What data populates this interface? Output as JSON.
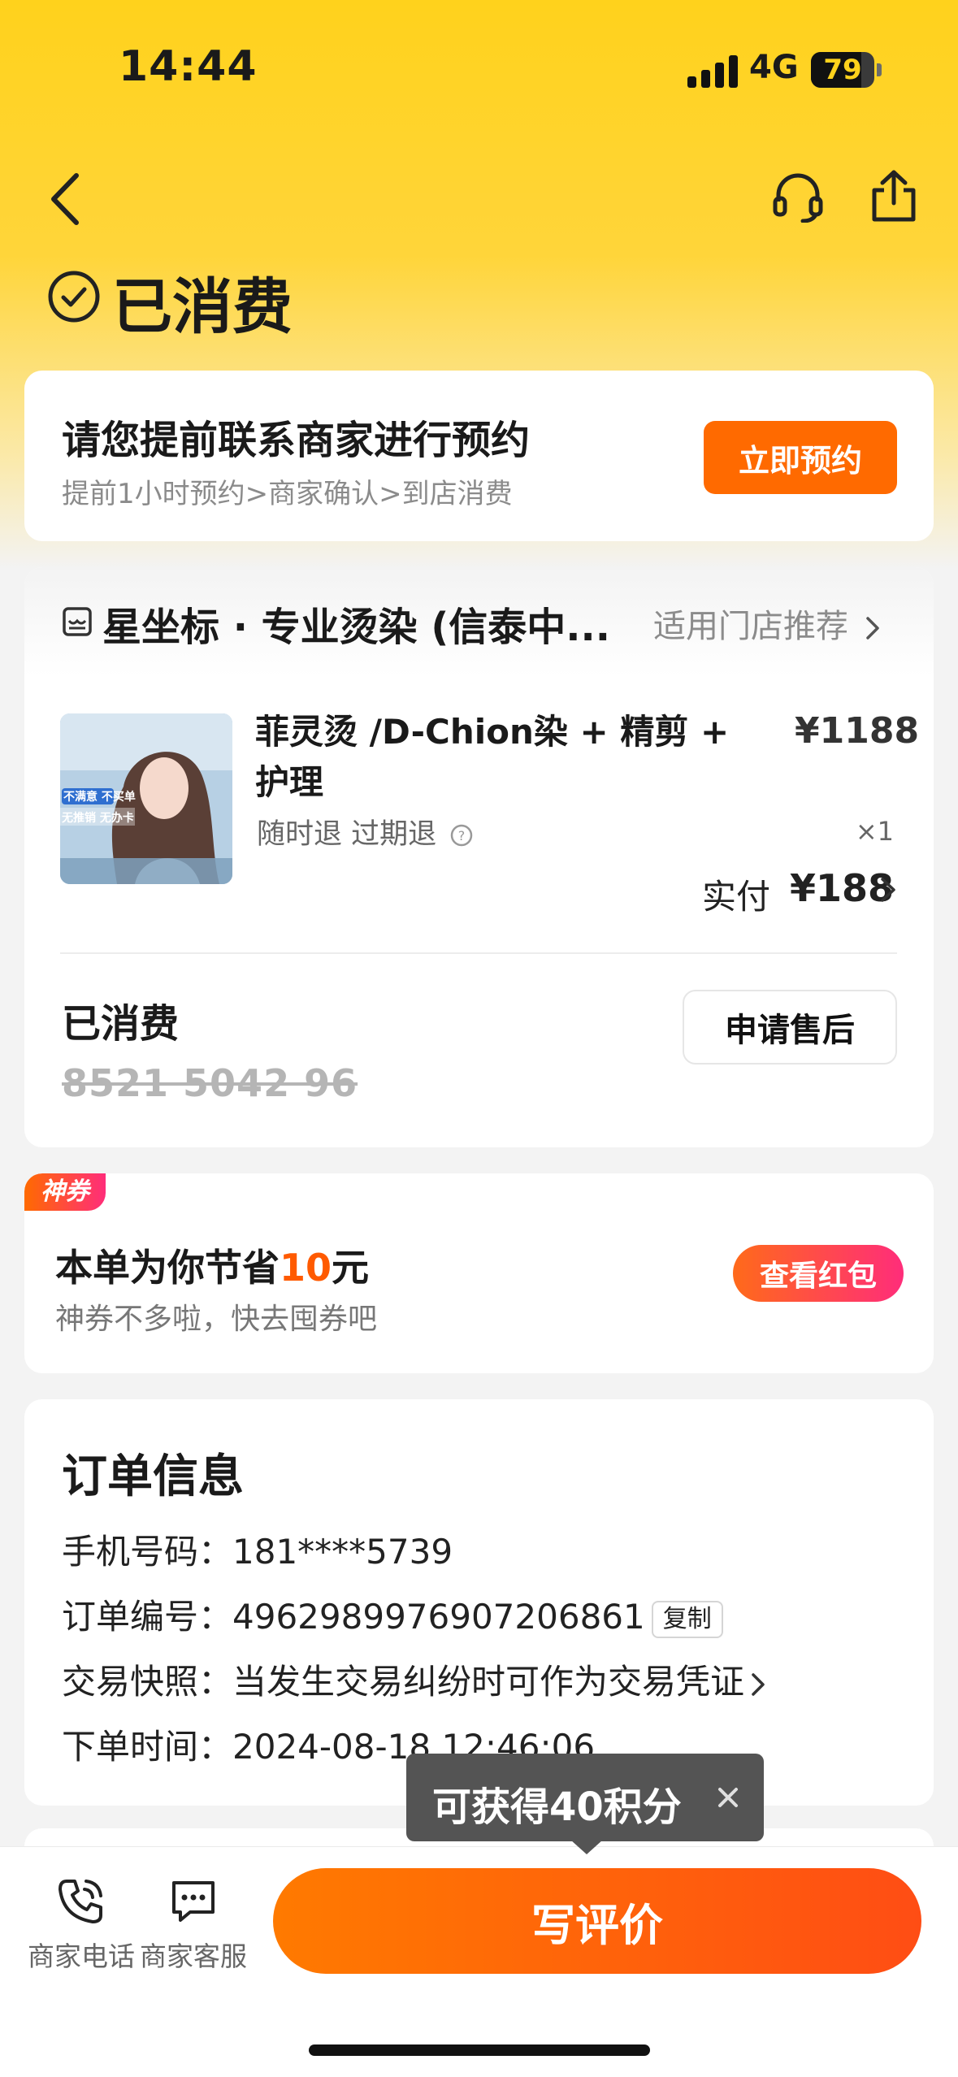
{
  "status_bar": {
    "time": "14:44",
    "network": "4G",
    "battery_level": 79,
    "battery_label": "79"
  },
  "header": {
    "status_title": "已消费",
    "icons": [
      "back-icon",
      "headset-icon",
      "share-icon",
      "check-circle-icon"
    ]
  },
  "reserve": {
    "title": "请您提前联系商家进行预约",
    "subtitle": "提前1小时预约>商家确认>到店消费",
    "button": "立即预约"
  },
  "shop": {
    "name": "星坐标 · 专业烫染 (信泰中...",
    "recommend": "适用门店推荐"
  },
  "product": {
    "image_badge_1": "不满意 不买单",
    "image_badge_2": "无推销 无办卡",
    "title": "菲灵烫 /D-Chion染 + 精剪 + 护理",
    "price": "¥1188",
    "refund_policy": "随时退 过期退",
    "quantity": "×1",
    "paid_label": "实付",
    "paid_value": "¥188"
  },
  "voucher": {
    "status": "已消费",
    "code": "8521 5042 96",
    "aftersale_button": "申请售后"
  },
  "coupon": {
    "badge": "神券",
    "title_prefix": "本单为你节省",
    "saved_amount": "10",
    "title_suffix": "元",
    "subtitle": "神券不多啦，快去囤券吧",
    "button": "查看红包"
  },
  "order_info": {
    "title": "订单信息",
    "phone_label": "手机号码：",
    "phone": "181****5739",
    "order_no_label": "订单编号：",
    "order_no": "4962989976907206861",
    "copy_button": "复制",
    "snapshot_label": "交易快照：",
    "snapshot": "当发生交易纠纷时可作为交易凭证",
    "time_label": "下单时间：",
    "time": "2024-08-18 12:46:06"
  },
  "tooltip": {
    "text": "可获得40积分"
  },
  "bottom_bar": {
    "phone_label": "商家电话",
    "service_label": "商家客服",
    "review_button": "写评价"
  },
  "colors": {
    "accent": "#ff6a00",
    "header_yellow": "#ffd21c",
    "coupon_pink": "#ff2d7a"
  }
}
